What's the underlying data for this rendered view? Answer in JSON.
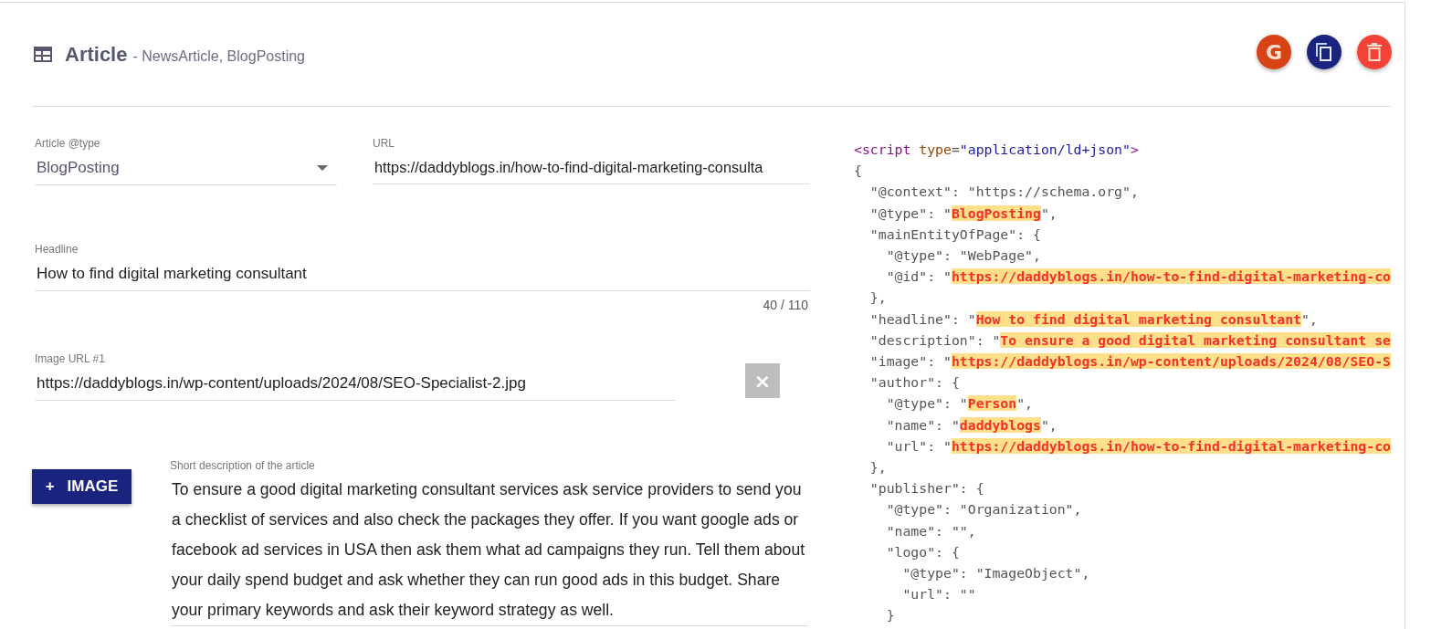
{
  "header": {
    "title": "Article",
    "subtitle": "- NewsArticle, BlogPosting"
  },
  "actions": [
    {
      "kind": "google",
      "label": "G"
    },
    {
      "kind": "copy"
    },
    {
      "kind": "delete"
    }
  ],
  "form": {
    "type_select": {
      "label": "Article @type",
      "value": "BlogPosting"
    },
    "url": {
      "label": "URL",
      "value": "https://daddyblogs.in/how-to-find-digital-marketing-consulta"
    },
    "headline": {
      "label": "Headline",
      "value": "How to find digital marketing consultant",
      "counter": "40 / 110"
    },
    "images": [
      {
        "label": "Image URL #1",
        "value": "https://daddyblogs.in/wp-content/uploads/2024/08/SEO-Specialist-2.jpg",
        "clear": "×"
      }
    ],
    "add_image": {
      "icon": "+",
      "label": "IMAGE"
    },
    "description": {
      "label": "Short description of the article",
      "value": "To ensure a good digital marketing consultant services ask service providers to send you a checklist of services and also check the packages they offer. If you want google ads or facebook ad services in USA then ask them what ad campaigns they run. Tell them about your daily spend budget and ask whether they can run good ads in this budget. Share your primary keywords and ask their keyword strategy as well."
    }
  },
  "code": [
    [
      {
        "kind": "tag",
        "text": "<script"
      },
      {
        "kind": "attr",
        "text": " type"
      },
      {
        "kind": "plain",
        "text": "="
      },
      {
        "kind": "val",
        "text": "\"application/ld+json\""
      },
      {
        "kind": "tag",
        "text": ">"
      }
    ],
    [
      {
        "kind": "plain",
        "text": "{"
      }
    ],
    [
      {
        "kind": "plain",
        "text": "  \"@context\": \"https://schema.org\","
      }
    ],
    [
      {
        "kind": "plain",
        "text": "  \"@type\": \""
      },
      {
        "kind": "hl",
        "text": "BlogPosting"
      },
      {
        "kind": "plain",
        "text": "\","
      }
    ],
    [
      {
        "kind": "plain",
        "text": "  \"mainEntityOfPage\": {"
      }
    ],
    [
      {
        "kind": "plain",
        "text": "    \"@type\": \"WebPage\","
      }
    ],
    [
      {
        "kind": "plain",
        "text": "    \"@id\": \""
      },
      {
        "kind": "hl",
        "text": "https://daddyblogs.in/how-to-find-digital-marketing-co"
      }
    ],
    [
      {
        "kind": "plain",
        "text": "  },"
      }
    ],
    [
      {
        "kind": "plain",
        "text": "  \"headline\": \""
      },
      {
        "kind": "hl",
        "text": "How to find digital marketing consultant"
      },
      {
        "kind": "plain",
        "text": "\","
      }
    ],
    [
      {
        "kind": "plain",
        "text": "  \"description\": \""
      },
      {
        "kind": "hl",
        "text": "To ensure a good digital marketing consultant se"
      }
    ],
    [
      {
        "kind": "plain",
        "text": "  \"image\": \""
      },
      {
        "kind": "hl",
        "text": "https://daddyblogs.in/wp-content/uploads/2024/08/SEO-S"
      }
    ],
    [
      {
        "kind": "plain",
        "text": "  \"author\": {"
      }
    ],
    [
      {
        "kind": "plain",
        "text": "    \"@type\": \""
      },
      {
        "kind": "hl",
        "text": "Person"
      },
      {
        "kind": "plain",
        "text": "\","
      }
    ],
    [
      {
        "kind": "plain",
        "text": "    \"name\": \""
      },
      {
        "kind": "hl",
        "text": "daddyblogs"
      },
      {
        "kind": "plain",
        "text": "\","
      }
    ],
    [
      {
        "kind": "plain",
        "text": "    \"url\": \""
      },
      {
        "kind": "hl",
        "text": "https://daddyblogs.in/how-to-find-digital-marketing-co"
      }
    ],
    [
      {
        "kind": "plain",
        "text": "  },"
      }
    ],
    [
      {
        "kind": "plain",
        "text": "  \"publisher\": {"
      }
    ],
    [
      {
        "kind": "plain",
        "text": "    \"@type\": \"Organization\","
      }
    ],
    [
      {
        "kind": "plain",
        "text": "    \"name\": \"\","
      }
    ],
    [
      {
        "kind": "plain",
        "text": "    \"logo\": {"
      }
    ],
    [
      {
        "kind": "plain",
        "text": "      \"@type\": \"ImageObject\","
      }
    ],
    [
      {
        "kind": "plain",
        "text": "      \"url\": \"\""
      }
    ],
    [
      {
        "kind": "plain",
        "text": "    }"
      }
    ]
  ]
}
